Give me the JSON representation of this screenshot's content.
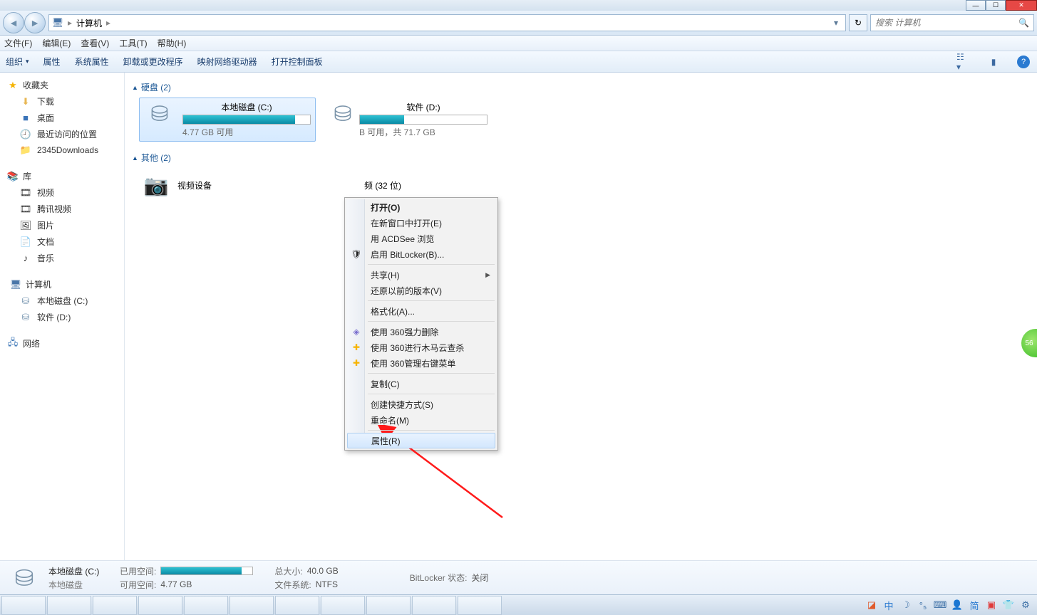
{
  "titlebar": {
    "min": "—",
    "max": "☐",
    "close": "✕"
  },
  "address": {
    "crumb_root_icon": "computer-icon",
    "crumb_root": "计算机",
    "dropdown_glyph": "▾",
    "refresh_glyph": "↻"
  },
  "search": {
    "placeholder": "搜索 计算机",
    "icon": "🔍"
  },
  "menu": {
    "file": "文件(F)",
    "edit": "编辑(E)",
    "view": "查看(V)",
    "tools": "工具(T)",
    "help": "帮助(H)"
  },
  "toolbar": {
    "organize": "组织",
    "organize_dd": "▾",
    "properties": "属性",
    "system_props": "系统属性",
    "uninstall": "卸载或更改程序",
    "map_drive": "映射网络驱动器",
    "open_cp": "打开控制面板",
    "help": "?"
  },
  "sidebar": {
    "fav_hdr": "收藏夹",
    "fav": {
      "downloads": "下载",
      "desktop": "桌面",
      "recent": "最近访问的位置",
      "d2345": "2345Downloads"
    },
    "lib_hdr": "库",
    "lib": {
      "video": "视频",
      "tencent": "腾讯视频",
      "pictures": "图片",
      "docs": "文档",
      "music": "音乐"
    },
    "computer_hdr": "计算机",
    "drives": {
      "c": "本地磁盘 (C:)",
      "d": "软件 (D:)"
    },
    "network_hdr": "网络"
  },
  "content": {
    "hdd_header": "硬盘 (2)",
    "other_header": "其他 (2)",
    "drive_c": {
      "name": "本地磁盘 (C:)",
      "free_text": "4.77 GB 可用",
      "fill_pct": 88
    },
    "drive_d": {
      "name": "软件 (D:)",
      "free_text": "B 可用，共 71.7 GB",
      "fill_pct_remaining": 35
    },
    "other1": "视频设备",
    "other2": "频 (32 位)"
  },
  "context_menu": {
    "open": "打开(O)",
    "open_new": "在新窗口中打开(E)",
    "acdsee": "用 ACDSee 浏览",
    "bitlocker": "启用 BitLocker(B)...",
    "share": "共享(H)",
    "restore": "还原以前的版本(V)",
    "format": "格式化(A)...",
    "del360": "使用 360强力删除",
    "scan360": "使用 360进行木马云查杀",
    "menu360": "使用 360管理右键菜单",
    "copy": "复制(C)",
    "shortcut": "创建快捷方式(S)",
    "rename": "重命名(M)",
    "props": "属性(R)"
  },
  "details": {
    "title": "本地磁盘 (C:)",
    "subtitle": "本地磁盘",
    "used_k": "已用空间:",
    "free_k": "可用空间:",
    "free_v": "4.77 GB",
    "total_k": "总大小:",
    "total_v": "40.0 GB",
    "fs_k": "文件系统:",
    "fs_v": "NTFS",
    "bl_k": "BitLocker 状态:",
    "bl_v": "关闭",
    "fill_pct": 88
  },
  "tray": {
    "ime": "中",
    "simp": "简"
  },
  "sidebadge": "56"
}
